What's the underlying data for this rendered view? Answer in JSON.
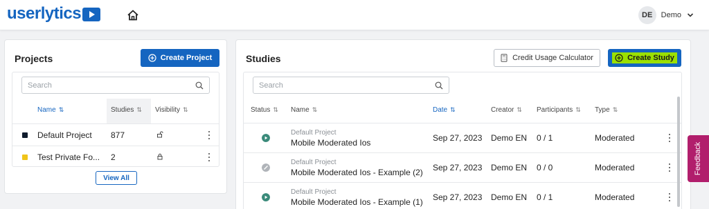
{
  "header": {
    "logo_text": "userlytics",
    "user_initials": "DE",
    "user_name": "Demo"
  },
  "projects": {
    "title": "Projects",
    "create_label": "Create Project",
    "search_placeholder": "Search",
    "columns": {
      "name": "Name",
      "studies": "Studies",
      "visibility": "Visibility"
    },
    "rows": [
      {
        "color": "#0f1b2d",
        "name": "Default Project",
        "studies": "877",
        "visibility": "unlocked"
      },
      {
        "color": "#f0c419",
        "name": "Test Private Fo...",
        "studies": "2",
        "visibility": "locked"
      }
    ],
    "view_all_label": "View All"
  },
  "studies": {
    "title": "Studies",
    "credit_label": "Credit Usage Calculator",
    "create_label": "Create Study",
    "search_placeholder": "Search",
    "columns": {
      "status": "Status",
      "name": "Name",
      "date": "Date",
      "creator": "Creator",
      "participants": "Participants",
      "type": "Type"
    },
    "rows": [
      {
        "status": "active",
        "project": "Default Project",
        "name": "Mobile Moderated Ios",
        "date": "Sep 27, 2023",
        "creator": "Demo EN",
        "participants": "0 / 1",
        "type": "Moderated"
      },
      {
        "status": "disabled",
        "project": "Default Project",
        "name": "Mobile Moderated Ios - Example (2)",
        "date": "Sep 27, 2023",
        "creator": "Demo EN",
        "participants": "0 / 0",
        "type": "Moderated"
      },
      {
        "status": "active",
        "project": "Default Project",
        "name": "Mobile Moderated Ios - Example (1)",
        "date": "Sep 27, 2023",
        "creator": "Demo EN",
        "participants": "0 / 1",
        "type": "Moderated"
      }
    ]
  },
  "feedback_label": "Feedback",
  "colors": {
    "primary": "#1565c0",
    "active_status": "#3a8a7a",
    "disabled_status": "#b0b4b9",
    "feedback": "#b11e6c",
    "highlight": "#9be000"
  }
}
